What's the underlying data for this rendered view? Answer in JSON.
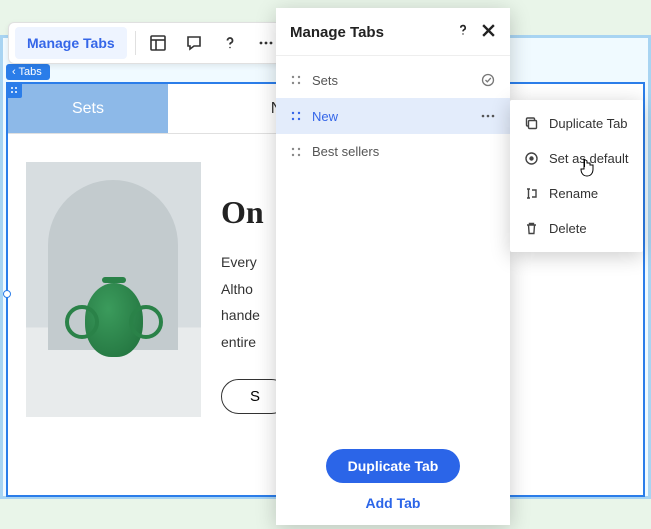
{
  "toolbar": {
    "manage_label": "Manage Tabs"
  },
  "badge": {
    "label": "Tabs"
  },
  "page_tabs": {
    "tab1": "Sets",
    "tab2": "New"
  },
  "product": {
    "title": "On",
    "line1": "Every",
    "line2": "Altho",
    "line3": "hande",
    "line4": "entire",
    "button": "S"
  },
  "panel": {
    "title": "Manage Tabs",
    "rows": {
      "r1": "Sets",
      "r2": "New",
      "r3": "Best sellers"
    },
    "primary_button": "Duplicate Tab",
    "secondary_button": "Add Tab"
  },
  "context": {
    "duplicate": "Duplicate Tab",
    "default": "Set as default",
    "rename": "Rename",
    "delete": "Delete"
  }
}
